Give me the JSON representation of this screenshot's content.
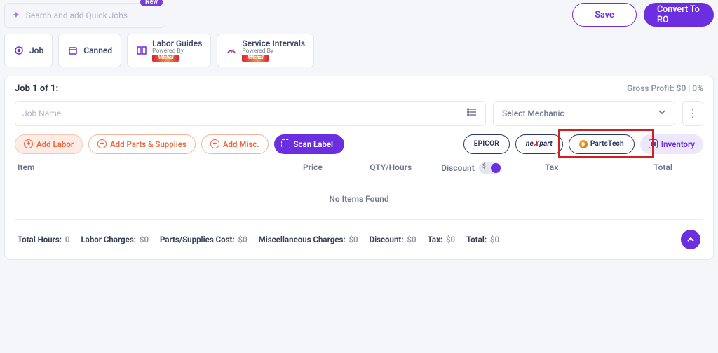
{
  "new_badge": "New",
  "search_placeholder": "Search and add Quick Jobs",
  "top_actions": {
    "save": "Save",
    "convert": "Convert To RO"
  },
  "tabs": {
    "job": "Job",
    "canned": "Canned",
    "labor_guides": "Labor Guides",
    "powered_by": "Powered By",
    "service_intervals": "Service Intervals"
  },
  "job": {
    "header": "Job 1 of 1:",
    "gross_profit": "Gross Profit: $0 | 0%",
    "name_placeholder": "Job Name",
    "mechanic_placeholder": "Select Mechanic"
  },
  "actions": {
    "add_labor": "Add Labor",
    "add_parts": "Add Parts & Supplies",
    "add_misc": "Add Misc.",
    "scan_label": "Scan Label",
    "inventory": "Inventory"
  },
  "vendors": {
    "epicor": "EPICOR",
    "nexpart_a": "ne",
    "nexpart_b": "part",
    "partstech": "PartsTech"
  },
  "columns": {
    "item": "Item",
    "price": "Price",
    "qty": "QTY/Hours",
    "discount": "Discount",
    "discount_toggle_symbol": "$",
    "tax": "Tax",
    "total": "Total"
  },
  "no_items": "No Items Found",
  "summary": {
    "total_hours_label": "Total Hours:",
    "total_hours_val": "0",
    "labor_label": "Labor Charges:",
    "labor_val": "$0",
    "parts_label": "Parts/Supplies Cost:",
    "parts_val": "$0",
    "misc_label": "Miscellaneous Charges:",
    "misc_val": "$0",
    "discount_label": "Discount:",
    "discount_val": "$0",
    "tax_label": "Tax:",
    "tax_val": "$0",
    "total_label": "Total:",
    "total_val": "$0"
  }
}
